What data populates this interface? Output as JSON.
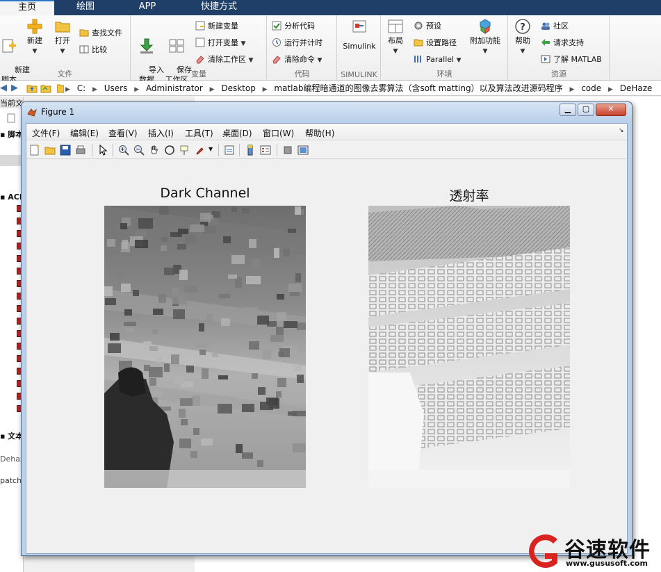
{
  "tabs": [
    {
      "label": "主页"
    },
    {
      "label": "绘图"
    },
    {
      "label": "APP"
    },
    {
      "label": "快捷方式"
    }
  ],
  "ribbon": {
    "file": {
      "label": "文件",
      "new_script": "新建\n脚本",
      "new": "新建",
      "open": "打开",
      "find_files": "查找文件",
      "compare": "比较"
    },
    "variable": {
      "label": "变量",
      "import": "导入\n数据",
      "save": "保存\n工作区",
      "new_var": "新建变量",
      "open_var": "打开变量",
      "clear_ws": "清除工作区"
    },
    "code": {
      "label": "代码",
      "analyze": "分析代码",
      "run_time": "运行并计时",
      "clear_cmd": "清除命令"
    },
    "simulink": {
      "label": "SIMULINK",
      "simulink": "Simulink"
    },
    "env": {
      "label": "环境",
      "layout": "布局",
      "prefs": "预设",
      "set_path": "设置路径",
      "parallel": "Parallel",
      "addons": "附加功能"
    },
    "resources": {
      "label": "资源",
      "help": "帮助",
      "community": "社区",
      "support": "请求支持",
      "learn": "了解 MATLAB"
    }
  },
  "address": {
    "crumbs": [
      "C:",
      "Users",
      "Administrator",
      "Desktop",
      "matlab编程暗通道的图像去雾算法（含soft matting）以及算法改进源码程序",
      "code",
      "DeHaze"
    ]
  },
  "left_panel": {
    "current_folder": "当前文件夹",
    "script_label": "脚本",
    "acd_label": "ACD",
    "text_label": "文本",
    "dehaze_text": "Dehaz",
    "patch_text": "patch"
  },
  "figure": {
    "title": "Figure 1",
    "menus": [
      "文件(F)",
      "编辑(E)",
      "查看(V)",
      "插入(I)",
      "工具(T)",
      "桌面(D)",
      "窗口(W)",
      "帮助(H)"
    ],
    "axes": [
      {
        "title": "Dark Channel"
      },
      {
        "title": "透射率"
      }
    ]
  },
  "watermark": {
    "text": "谷速软件",
    "url": "www.gususoft.com"
  }
}
